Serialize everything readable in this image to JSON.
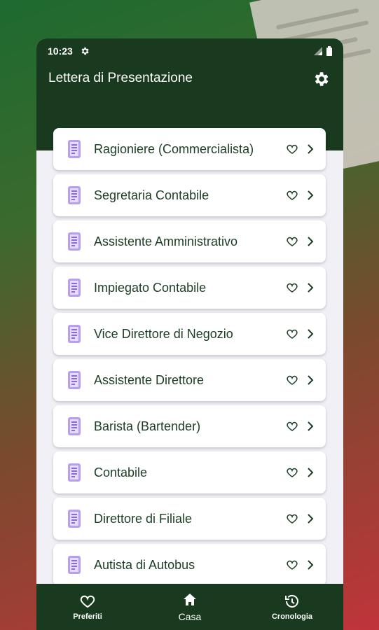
{
  "status_bar": {
    "time": "10:23"
  },
  "header": {
    "title": "Lettera di Presentazione",
    "settings_icon": "gear-icon"
  },
  "list": {
    "items": [
      {
        "label": "Ragioniere (Commercialista)"
      },
      {
        "label": "Segretaria Contabile"
      },
      {
        "label": "Assistente Amministrativo"
      },
      {
        "label": "Impiegato Contabile"
      },
      {
        "label": "Vice Direttore di Negozio"
      },
      {
        "label": "Assistente Direttore"
      },
      {
        "label": "Barista (Bartender)"
      },
      {
        "label": "Contabile"
      },
      {
        "label": "Direttore di Filiale"
      },
      {
        "label": "Autista di Autobus"
      }
    ]
  },
  "bottom_nav": {
    "items": [
      {
        "label": "Preferiti",
        "icon": "heart-icon"
      },
      {
        "label": "Casa",
        "icon": "home-icon",
        "active": true
      },
      {
        "label": "Cronologia",
        "icon": "history-icon"
      }
    ]
  },
  "colors": {
    "header_bg": "#193a1e",
    "label_text": "#1b3d23",
    "icon_purple": "#8a6bd6"
  }
}
